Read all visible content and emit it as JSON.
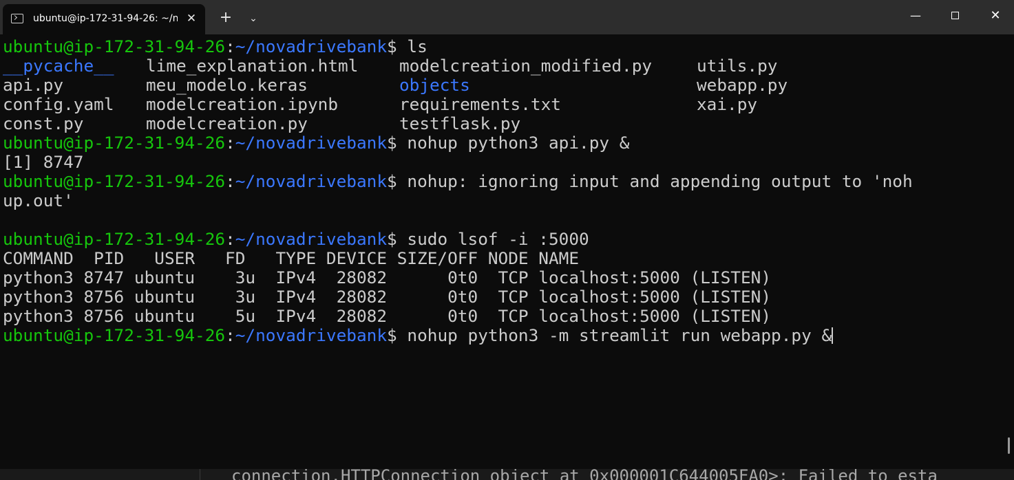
{
  "window": {
    "tab_title": "ubuntu@ip-172-31-94-26: ~/n",
    "tab_close": "✕",
    "new_tab": "+",
    "dropdown": "⌄",
    "minimize": "—",
    "close": "✕"
  },
  "terminal": {
    "prompt_user": "ubuntu@ip-172-31-94-26",
    "prompt_sep": ":",
    "prompt_path": "~/novadrivebank",
    "prompt_end": "$ ",
    "cmd_ls": "ls",
    "ls_row1": {
      "c1": "__pycache__",
      "c2": "lime_explanation.html",
      "c3": "modelcreation_modified.py",
      "c4": "utils.py"
    },
    "ls_row2": {
      "c1": "api.py",
      "c2": "meu_modelo.keras",
      "c3": "objects",
      "c4": "webapp.py"
    },
    "ls_row3": {
      "c1": "config.yaml",
      "c2": "modelcreation.ipynb",
      "c3": "requirements.txt",
      "c4": "xai.py"
    },
    "ls_row4": {
      "c1": "const.py",
      "c2": "modelcreation.py",
      "c3": "testflask.py"
    },
    "cmd_nohup_api": "nohup python3 api.py &",
    "job_line": "[1] 8747",
    "nohup_msg": "nohup: ignoring input and appending output to 'noh",
    "nohup_msg_cont": "up.out'",
    "cmd_lsof": "sudo lsof -i :5000",
    "lsof_header": "COMMAND  PID   USER   FD   TYPE DEVICE SIZE/OFF NODE NAME",
    "lsof_rows": [
      "python3 8747 ubuntu    3u  IPv4  28082      0t0  TCP localhost:5000 (LISTEN)",
      "python3 8756 ubuntu    3u  IPv4  28082      0t0  TCP localhost:5000 (LISTEN)",
      "python3 8756 ubuntu    5u  IPv4  28082      0t0  TCP localhost:5000 (LISTEN)"
    ],
    "cmd_streamlit": "nohup python3 -m streamlit run webapp.py &"
  },
  "background_text": "connection.HTTPConnection object at 0x000001C644005FA0>: Failed to esta",
  "colors": {
    "background": "#0c0c0c",
    "prompt_user": "#16c60c",
    "prompt_path": "#3b78ff",
    "text": "#cccccc",
    "titlebar": "#2d2d2d"
  }
}
